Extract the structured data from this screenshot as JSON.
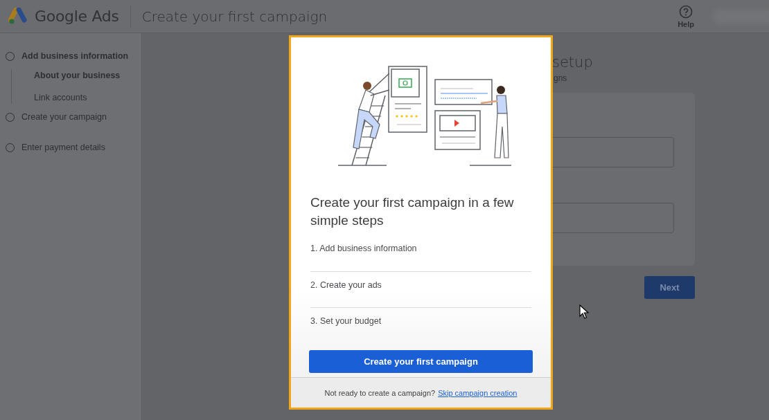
{
  "header": {
    "logo_text": "Google Ads",
    "title": "Create your first campaign",
    "help_label": "Help"
  },
  "sidebar": {
    "steps": [
      {
        "label": "Add business information",
        "selected": true,
        "children": [
          {
            "label": "About your business",
            "selected": true
          },
          {
            "label": "Link accounts",
            "selected": false
          }
        ]
      },
      {
        "label": "Create your campaign",
        "selected": false
      },
      {
        "label": "Enter payment details",
        "selected": false
      }
    ]
  },
  "page": {
    "heading": "setup",
    "subheading": "gns",
    "next_button": "Next"
  },
  "dialog": {
    "title": "Create your first campaign in a few simple steps",
    "steps": [
      "1. Add business information",
      "2. Create your ads",
      "3. Set your budget"
    ],
    "primary_button": "Create your first campaign",
    "footer_text": "Not ready to create a campaign?",
    "footer_link": "Skip campaign creation"
  }
}
